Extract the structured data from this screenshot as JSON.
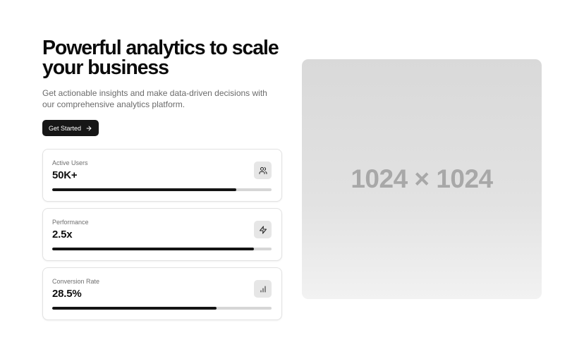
{
  "hero": {
    "title": "Powerful analytics to scale your business",
    "subtitle": "Get actionable insights and make data-driven decisions with our comprehensive analytics platform.",
    "cta_label": "Get Started",
    "cta_icon": "arrow-right-icon"
  },
  "stats": [
    {
      "label": "Active Users",
      "value": "50K+",
      "icon": "users-icon",
      "progress": 0.84
    },
    {
      "label": "Performance",
      "value": "2.5x",
      "icon": "zap-icon",
      "progress": 0.92
    },
    {
      "label": "Conversion Rate",
      "value": "28.5%",
      "icon": "bar-chart-icon",
      "progress": 0.75
    }
  ],
  "image_placeholder": {
    "text": "1024 × 1024"
  },
  "colors": {
    "primary": "#161616",
    "track": "#d6d6d6",
    "muted_text": "#6b6b6b"
  }
}
